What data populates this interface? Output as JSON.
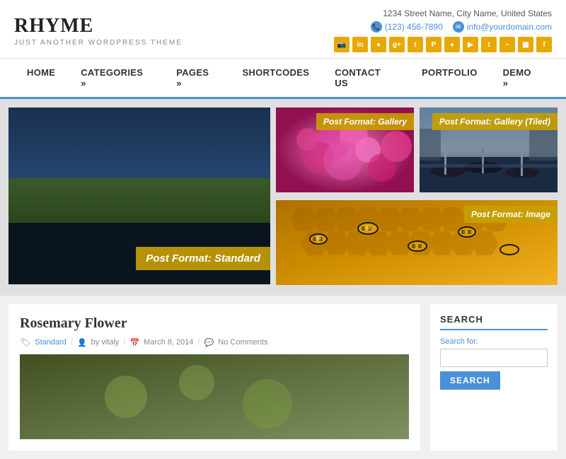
{
  "header": {
    "logo": "RHYME",
    "tagline": "JUST ANOTHER WORDPRESS THEME",
    "address": "1234 Street Name, City Name, United States",
    "phone": "(123) 456-7890",
    "email": "info@yourdomain.com"
  },
  "social_icons": [
    "📷",
    "in",
    "●",
    "g+",
    "t",
    "℗",
    "●",
    "▶",
    "🐦",
    "~",
    "▦",
    "f"
  ],
  "social_labels": [
    "instagram",
    "linkedin",
    "circle",
    "google-plus",
    "tumblr",
    "pinterest",
    "circle2",
    "youtube",
    "twitter",
    "rss",
    "flickr",
    "facebook"
  ],
  "nav": {
    "items": [
      {
        "label": "HOME",
        "has_arrow": false
      },
      {
        "label": "CATEGORIES »",
        "has_arrow": true
      },
      {
        "label": "PAGES »",
        "has_arrow": true
      },
      {
        "label": "SHORTCODES",
        "has_arrow": false
      },
      {
        "label": "CONTACT US",
        "has_arrow": false
      },
      {
        "label": "PORTFOLIO",
        "has_arrow": false
      },
      {
        "label": "DEMO »",
        "has_arrow": true
      }
    ]
  },
  "featured": {
    "main_label": "Post Format: Standard",
    "grid": [
      {
        "label": "Post Format: Gallery"
      },
      {
        "label": "Post Format: Gallery (Tiled)"
      },
      {
        "label": "Post Format: Image"
      }
    ]
  },
  "post": {
    "title": "Rosemary Flower",
    "category": "Standard",
    "author": "by vitaly",
    "date": "March 8, 2014",
    "comments": "No Comments"
  },
  "sidebar": {
    "search_title": "SEARCH",
    "search_label": "Search for:",
    "search_placeholder": "",
    "search_btn": "SEARCH"
  }
}
